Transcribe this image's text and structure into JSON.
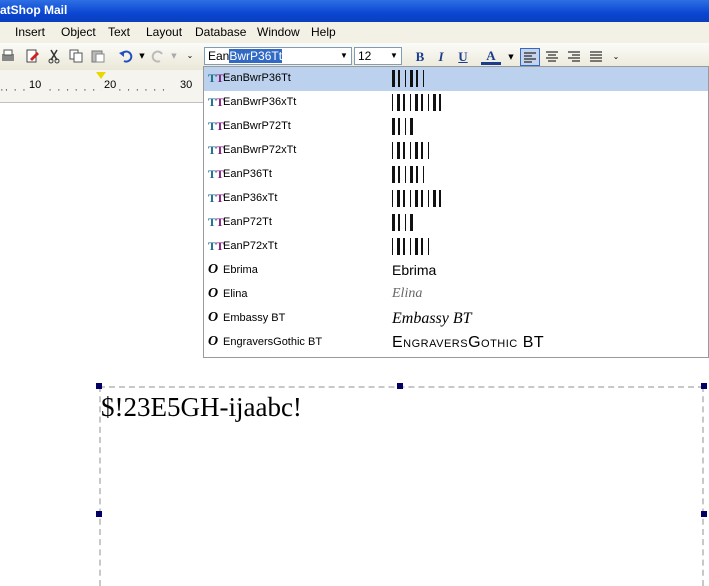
{
  "window": {
    "title": "atShop Mail"
  },
  "menu": [
    "Insert",
    "Object",
    "Text",
    "Layout",
    "Database",
    "Window",
    "Help"
  ],
  "toolbar": {
    "font_value_prefix": "Ean",
    "font_value_selected": "BwrP36Tt",
    "size_value": "12",
    "bold_label": "B",
    "italic_label": "I",
    "underline_label": "U",
    "color_label": "A",
    "accent_color": "#316ac5"
  },
  "ruler": {
    "labels": [
      "10",
      "20",
      "30"
    ]
  },
  "font_list": [
    {
      "name": "EanBwrP36Tt",
      "kind": "truetype",
      "preview": "",
      "selected": true
    },
    {
      "name": "EanBwrP36xTt",
      "kind": "truetype",
      "preview": ""
    },
    {
      "name": "EanBwrP72Tt",
      "kind": "truetype",
      "preview": ""
    },
    {
      "name": "EanBwrP72xTt",
      "kind": "truetype",
      "preview": ""
    },
    {
      "name": "EanP36Tt",
      "kind": "truetype",
      "preview": ""
    },
    {
      "name": "EanP36xTt",
      "kind": "truetype",
      "preview": ""
    },
    {
      "name": "EanP72Tt",
      "kind": "truetype",
      "preview": ""
    },
    {
      "name": "EanP72xTt",
      "kind": "truetype",
      "preview": ""
    },
    {
      "name": "Ebrima",
      "kind": "opentype",
      "preview": "Ebrima"
    },
    {
      "name": "Elina",
      "kind": "opentype",
      "preview": "Elina"
    },
    {
      "name": "Embassy BT",
      "kind": "opentype",
      "preview": "Embassy BT"
    },
    {
      "name": "EngraversGothic BT",
      "kind": "opentype",
      "preview": "EngraversGothic BT"
    }
  ],
  "document": {
    "text": "$!23E5GH-ijaabc!"
  }
}
